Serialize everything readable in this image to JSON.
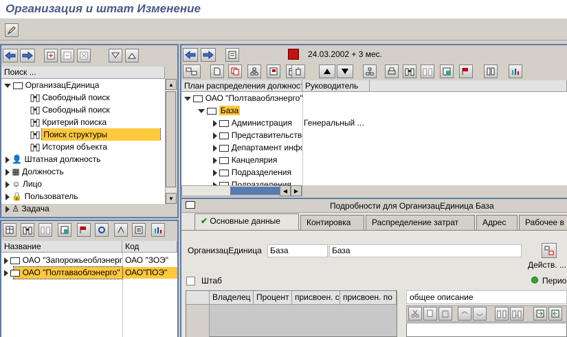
{
  "window": {
    "title": "Организация и штат Изменение"
  },
  "search_panel": {
    "header": "Поиск ...",
    "root": "ОрганизацЕдиница",
    "items": [
      "Свободный поиск",
      "Свободный поиск",
      "Критерий поиска",
      "Поиск структуры",
      "История объекта"
    ],
    "categories": [
      "Штатная должность",
      "Должность",
      "Лицо",
      "Пользователь",
      "Задача"
    ]
  },
  "result_list": {
    "headers": [
      "Название",
      "Код"
    ],
    "rows": [
      {
        "name": "ОАО \"Запорожьеоблэнерго\"",
        "code": "ОАО \"ЗОЭ\""
      },
      {
        "name": "ОАО \"Полтаваоблэнерго\"",
        "code": "ОАО\"ПОЭ\""
      }
    ]
  },
  "structure": {
    "date_text": "24.03.2002  + 3 мес.",
    "headers": [
      "План распределения должностей",
      "Руководитель"
    ],
    "root": "ОАО \"Полтаваоблэнерго\"",
    "node": "База",
    "children": [
      {
        "name": "Администрация",
        "head": "Генеральный ..."
      },
      {
        "name": "Представительство",
        "head": ""
      },
      {
        "name": "Департамент информатизации",
        "head": ""
      },
      {
        "name": "Канцелярия",
        "head": ""
      },
      {
        "name": "Подразделения",
        "head": ""
      },
      {
        "name": "Подразделения",
        "head": ""
      }
    ]
  },
  "details": {
    "title": "Подробности для ОрганизацЕдиница База",
    "tabs": [
      "Основные данные",
      "Контировка",
      "Распределение затрат",
      "Адрес",
      "Рабочее в"
    ],
    "org_label": "ОрганизацЕдиница",
    "short_value": "База",
    "long_value": "База",
    "actions_label": "Действ. ...",
    "staff_label": "Штаб",
    "period_label": "Перио",
    "table_headers": [
      "Владелец",
      "Процент",
      "присвоен. с",
      "присвоен. по"
    ],
    "description_label": "общее описание"
  },
  "colors": {
    "highlight": "#ffc83d",
    "frame": "#5a7bb0",
    "title": "#4a5a86"
  }
}
